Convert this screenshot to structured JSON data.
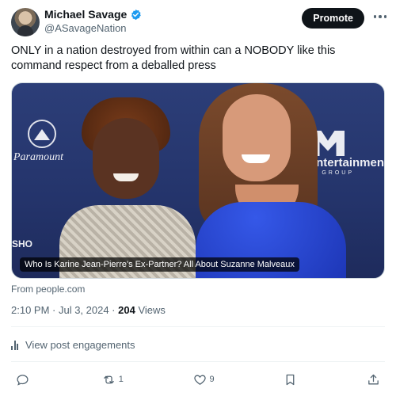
{
  "header": {
    "display_name": "Michael Savage",
    "handle": "@ASavageNation",
    "promote_label": "Promote"
  },
  "post": {
    "text": "ONLY in a nation destroyed from within can a NOBODY like this command respect from a deballed press"
  },
  "media": {
    "caption": "Who Is Karine Jean-Pierre's Ex-Partner? All About Suzanne Malveaux",
    "background_logos": {
      "paramount": "Paramount",
      "entertainment": "Entertainmen",
      "group": "GROUP",
      "sho": "SHO"
    }
  },
  "source": "From people.com",
  "meta": {
    "timestamp": "2:10 PM · Jul 3, 2024 · ",
    "views_count": "204",
    "views_label": " Views"
  },
  "engagements_label": "View post engagements",
  "actions": {
    "reply_count": "",
    "repost_count": "1",
    "like_count": "9"
  },
  "colors": {
    "text_primary": "#0f1419",
    "text_secondary": "#536471",
    "verified": "#1d9bf0",
    "button_bg": "#0f1419"
  },
  "icons": [
    "verified-badge-icon",
    "more-icon",
    "bars-icon",
    "reply-icon",
    "repost-icon",
    "like-icon",
    "bookmark-icon",
    "share-icon"
  ]
}
